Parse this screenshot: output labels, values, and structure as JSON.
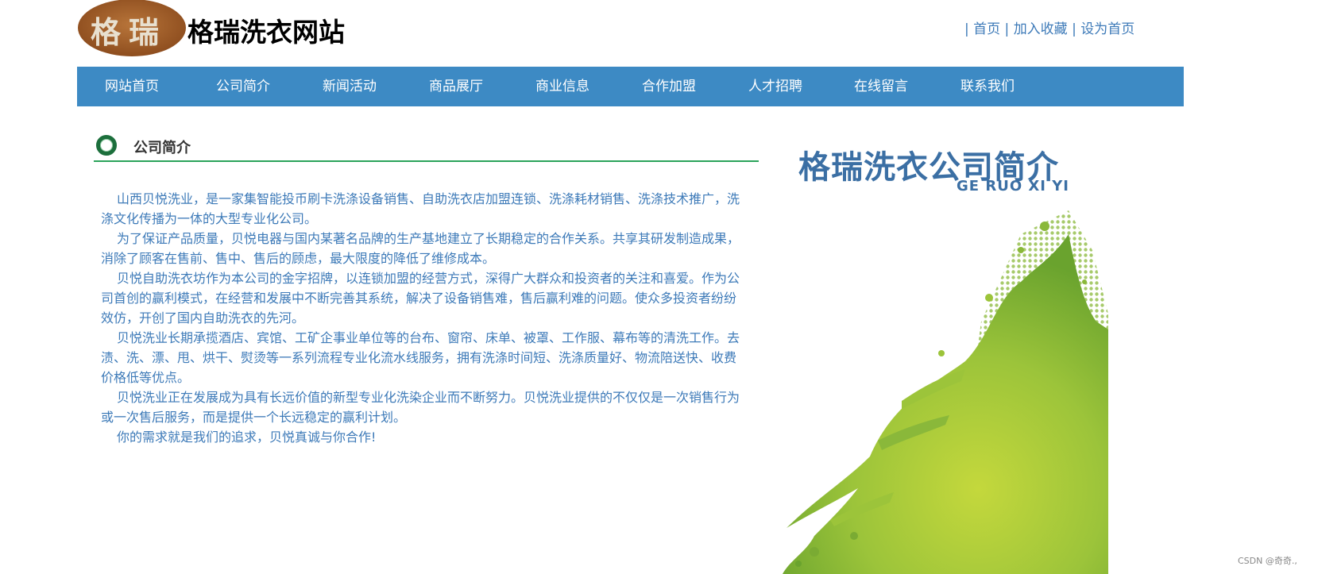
{
  "header": {
    "logo_text": "格瑞",
    "site_title": "格瑞洗衣网站",
    "links": [
      {
        "label": "首页"
      },
      {
        "label": "加入收藏"
      },
      {
        "label": "设为首页"
      }
    ],
    "separator": "|"
  },
  "nav": {
    "items": [
      {
        "label": "网站首页"
      },
      {
        "label": "公司简介"
      },
      {
        "label": "新闻活动"
      },
      {
        "label": "商品展厅"
      },
      {
        "label": "商业信息"
      },
      {
        "label": "合作加盟"
      },
      {
        "label": "人才招聘"
      },
      {
        "label": "在线留言"
      },
      {
        "label": "联系我们"
      }
    ]
  },
  "section": {
    "title": "公司简介"
  },
  "intro": {
    "paragraphs": [
      "山西贝悦洗业，是一家集智能投币刷卡洗涤设备销售、自助洗衣店加盟连锁、洗涤耗材销售、洗涤技术推广，洗涤文化传播为一体的大型专业化公司。",
      "为了保证产品质量，贝悦电器与国内某著名品牌的生产基地建立了长期稳定的合作关系。共享其研发制造成果，消除了顾客在售前、售中、售后的顾虑，最大限度的降低了维修成本。",
      "贝悦自助洗衣坊作为本公司的金字招牌，以连锁加盟的经营方式，深得广大群众和投资者的关注和喜爱。作为公司首创的赢利模式，在经营和发展中不断完善其系统，解决了设备销售难，售后赢利难的问题。使众多投资者纷纷效仿，开创了国内自助洗衣的先河。",
      "贝悦洗业长期承揽酒店、宾馆、工矿企事业单位等的台布、窗帘、床单、被罩、工作服、幕布等的清洗工作。去渍、洗、漂、甩、烘干、熨烫等一系列流程专业化流水线服务，拥有洗涤时间短、洗涤质量好、物流陪送快、收费价格低等优点。",
      "贝悦洗业正在发展成为具有长远价值的新型专业化洗染企业而不断努力。贝悦洗业提供的不仅仅是一次销售行为或一次售后服务，而是提供一个长远稳定的赢利计划。",
      "你的需求就是我们的追求，贝悦真诚与你合作!"
    ]
  },
  "side": {
    "title": "格瑞洗衣公司简介",
    "subtitle": "GE RUO XI YI"
  },
  "watermark": "CSDN @奇奇.,",
  "colors": {
    "nav_bg": "#3d8ac4",
    "link": "#3d7ab8",
    "heading_line": "#2aa35a",
    "splash_green": "#9cc43a"
  }
}
